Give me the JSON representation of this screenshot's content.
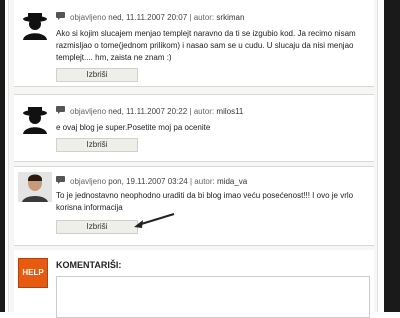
{
  "comments": [
    {
      "prefix": "objavljeno",
      "date": "ned, 11.11.2007 20:07",
      "author_label": "autor:",
      "author": "srkiman",
      "text": "Ako si kojim slucajem menjao templejt naravno da ti se izgubio kod. Ja recimo nisam razmisljao o tome(jednom prilikom) i nasao sam se u cudu. U slucaju da nisi menjao templejt.... hm, zaista ne znam :)",
      "delete_label": "Izbriši"
    },
    {
      "prefix": "objavljeno",
      "date": "ned, 11.11.2007 20:22",
      "author_label": "autor:",
      "author": "milos11",
      "text": "e ovaj blog je super.Posetite moj pa ocenite",
      "delete_label": "Izbriši"
    },
    {
      "prefix": "objavljeno",
      "date": "pon, 19.11.2007 03:24",
      "author_label": "autor:",
      "author": "mida_va",
      "text": "To je jednostavno neophodno uraditi da bi blog imao veću posećenost!!! I ovo je vrlo korisna informacija",
      "delete_label": "Izbriši"
    }
  ],
  "separator": "|",
  "comment_form": {
    "icon_label": "HELP",
    "title": "KOMENTARIŠI:"
  },
  "colors": {
    "help_orange": "#e85a12",
    "panel_bg": "#f6f6f4",
    "edge_dark": "#1a1a1a"
  },
  "icons": {
    "avatar_default": "silhouette-avatar-icon",
    "comment": "speech-bubble-icon",
    "annotation": "arrow-icon"
  }
}
